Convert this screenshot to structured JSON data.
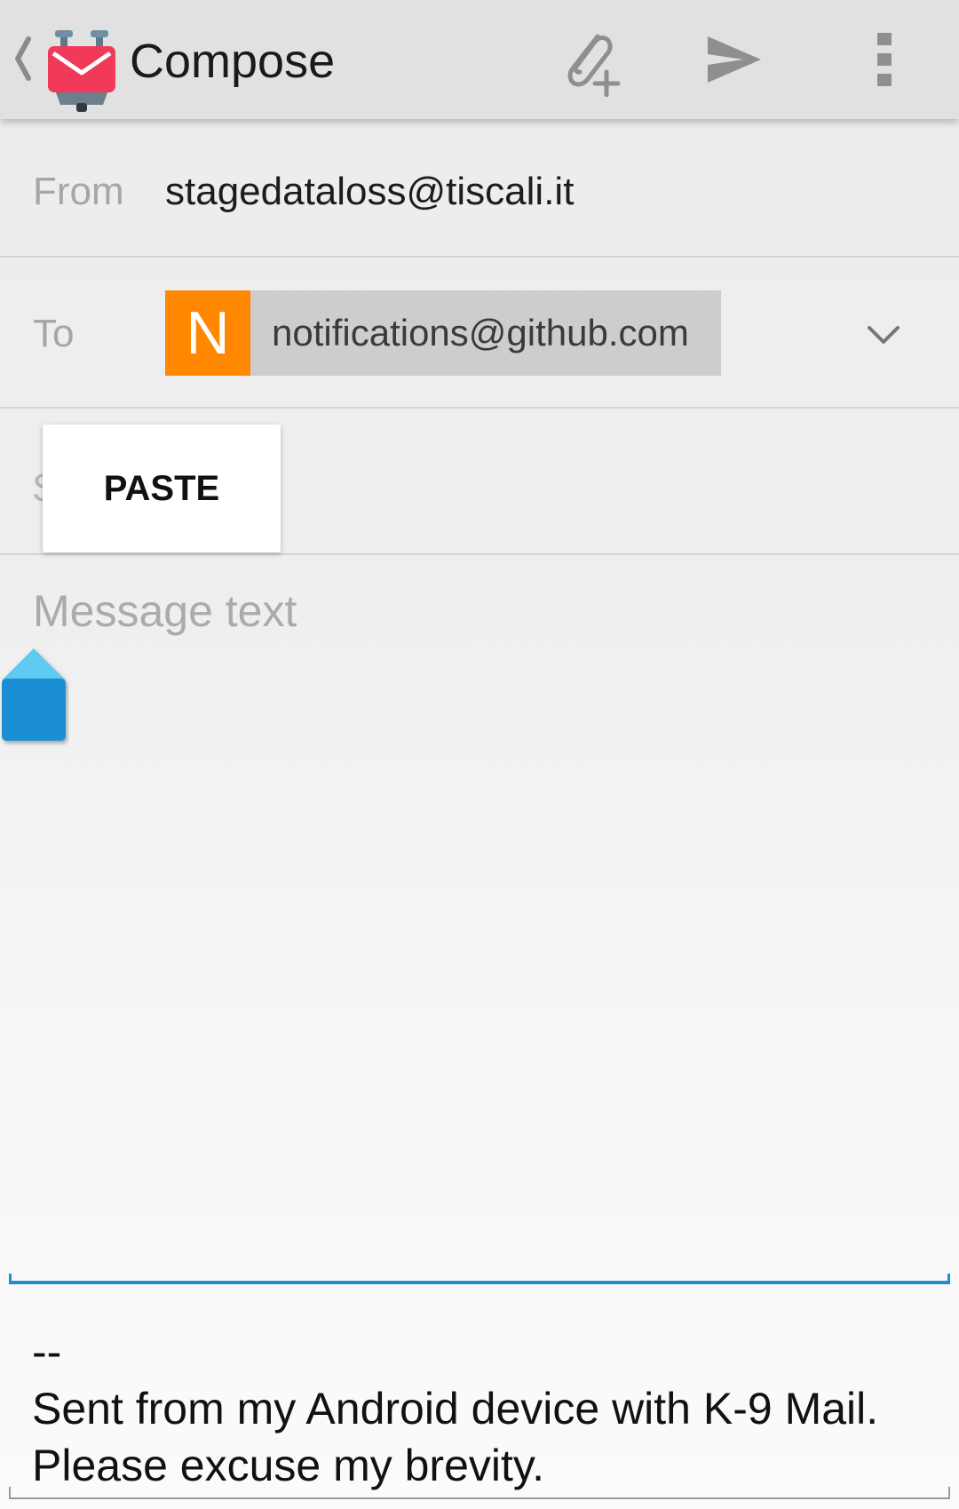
{
  "action_bar": {
    "title": "Compose",
    "icons": {
      "back": "chevron-left-icon",
      "logo": "k9-mail-logo",
      "attach": "paperclip-plus-icon",
      "send": "send-icon",
      "overflow": "more-vertical-icon"
    }
  },
  "form": {
    "from": {
      "label": "From",
      "value": "stagedataloss@tiscali.it"
    },
    "to": {
      "label": "To",
      "recipients": [
        {
          "avatar_letter": "N",
          "address": "notifications@github.com",
          "avatar_color": "#ff8800"
        }
      ]
    },
    "subject": {
      "label_visible_fragment": "S"
    }
  },
  "context_menu": {
    "paste_label": "PASTE"
  },
  "message": {
    "placeholder": "Message text",
    "signature_dash": "--",
    "signature_text": "Sent from my Android device with K-9 Mail. Please excuse my brevity."
  },
  "colors": {
    "accent": "#1e8fc8",
    "logo_red": "#f1395a",
    "avatar_orange": "#ff8800",
    "action_bar_bg": "#e1e1e1"
  }
}
